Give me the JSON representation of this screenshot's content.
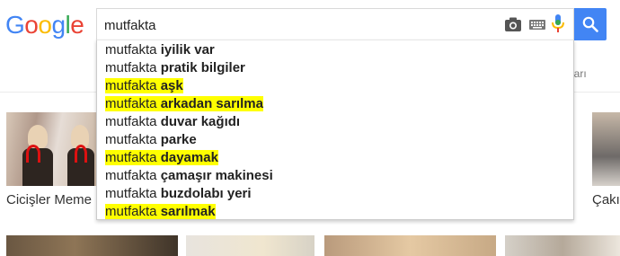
{
  "logo": {
    "text": "Google",
    "letters": [
      "G",
      "o",
      "o",
      "g",
      "l",
      "e"
    ],
    "colors": [
      "#4285f4",
      "#ea4335",
      "#fbbc05",
      "#4285f4",
      "#34a853",
      "#ea4335"
    ]
  },
  "search": {
    "value": "mutfakta",
    "button_color": "#4285f4"
  },
  "icons": {
    "camera": "camera-icon",
    "keyboard": "keyboard-icon",
    "mic": "mic-icon",
    "search": "search-icon"
  },
  "nav": {
    "right_text": "çları"
  },
  "suggestions": [
    {
      "prefix": "mutfakta",
      "completion": "iyilik var",
      "highlighted": false
    },
    {
      "prefix": "mutfakta",
      "completion": "pratik bilgiler",
      "highlighted": false
    },
    {
      "prefix": "mutfakta",
      "completion": "aşk",
      "highlighted": true
    },
    {
      "prefix": "mutfakta",
      "completion": "arkadan sarılma",
      "highlighted": true
    },
    {
      "prefix": "mutfakta",
      "completion": "duvar kağıdı",
      "highlighted": false
    },
    {
      "prefix": "mutfakta",
      "completion": "parke",
      "highlighted": false
    },
    {
      "prefix": "mutfakta",
      "completion": "dayamak",
      "highlighted": true
    },
    {
      "prefix": "mutfakta",
      "completion": "çamaşır makinesi",
      "highlighted": false
    },
    {
      "prefix": "mutfakta",
      "completion": "buzdolabı yeri",
      "highlighted": false
    },
    {
      "prefix": "mutfakta",
      "completion": "sarılmak",
      "highlighted": true
    }
  ],
  "highlight_color": "#ffff00",
  "image_results": {
    "captions": [
      "Cicişler Meme",
      "Çakı"
    ]
  }
}
